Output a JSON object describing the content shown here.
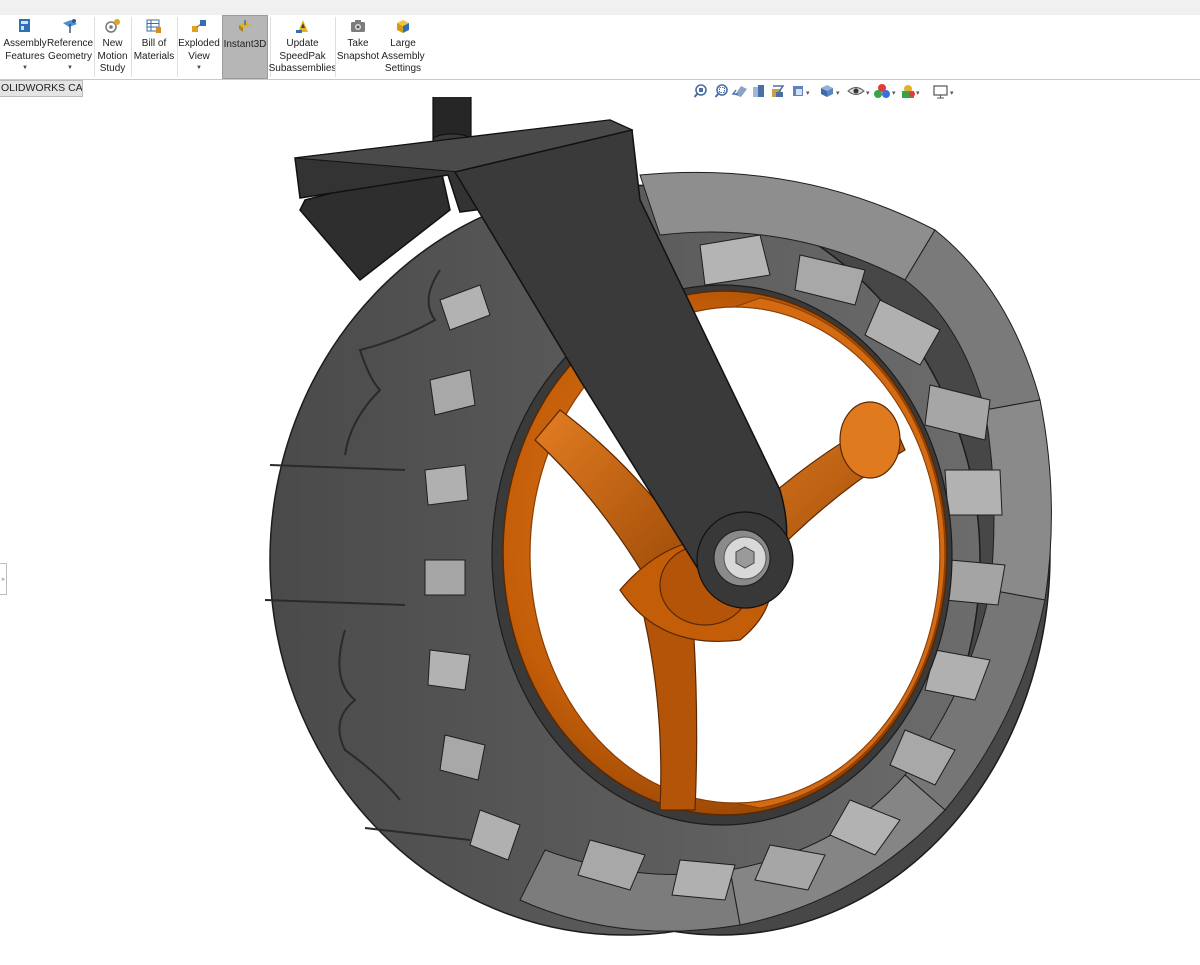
{
  "ribbon": {
    "buttons": [
      {
        "id": "assembly-features",
        "lines": [
          "Assembly",
          "Features"
        ],
        "dropdown": true
      },
      {
        "id": "reference-geometry",
        "lines": [
          "Reference",
          "Geometry"
        ],
        "dropdown": true
      },
      {
        "id": "new-motion-study",
        "lines": [
          "New",
          "Motion",
          "Study"
        ],
        "dropdown": false
      },
      {
        "id": "bill-of-materials",
        "lines": [
          "Bill of",
          "Materials"
        ],
        "dropdown": false
      },
      {
        "id": "exploded-view",
        "lines": [
          "Exploded",
          "View"
        ],
        "dropdown": true
      },
      {
        "id": "instant3d",
        "lines": [
          "Instant3D"
        ],
        "dropdown": false,
        "active": true
      },
      {
        "id": "update-speedpak",
        "lines": [
          "Update",
          "SpeedPak",
          "Subassemblies"
        ],
        "dropdown": false
      },
      {
        "id": "take-snapshot",
        "lines": [
          "Take",
          "Snapshot"
        ],
        "dropdown": false
      },
      {
        "id": "large-assembly-settings",
        "lines": [
          "Large",
          "Assembly",
          "Settings"
        ],
        "dropdown": false
      }
    ]
  },
  "tabs": {
    "cam_label": "OLIDWORKS CAM"
  },
  "heads_up_toolbar": [
    "zoom-to-fit-icon",
    "zoom-to-area-icon",
    "previous-view-icon",
    "section-view-icon",
    "dynamic-annotation-icon",
    "view-orientation-icon",
    "display-style-icon",
    "hide-show-items-icon",
    "edit-appearance-icon",
    "apply-scene-icon",
    "view-settings-icon"
  ],
  "model": {
    "name": "wheel-assembly",
    "colors": {
      "hub": "#c35d08",
      "hub_light": "#e07a1e",
      "hub_dark": "#6a3004",
      "tire": "#5a5a5a",
      "tire_dark": "#3e3e3e",
      "tire_light": "#9a9a9a",
      "fork": "#3c3c3c",
      "fork_edge": "#1e1e1e",
      "bolt": "#cfcfcf"
    }
  }
}
